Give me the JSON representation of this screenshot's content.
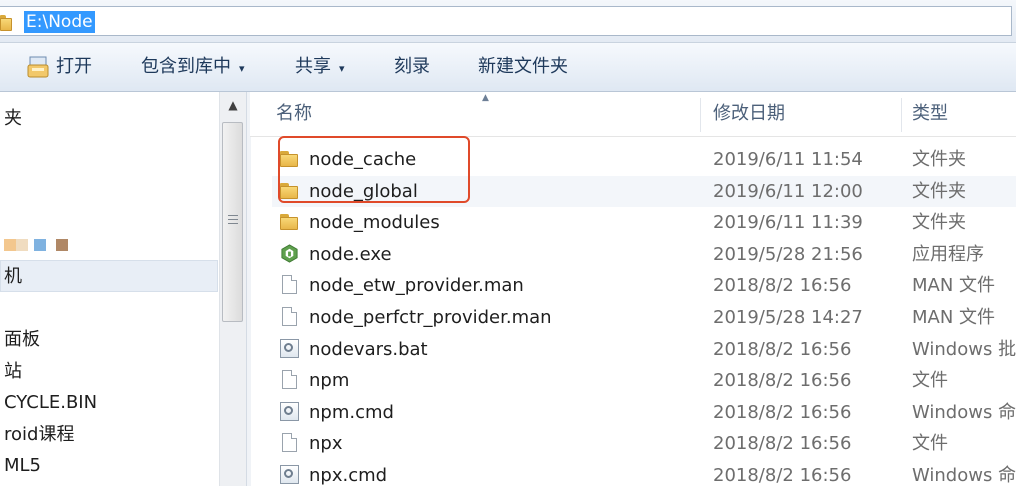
{
  "address_bar": {
    "path": "E:\\Node"
  },
  "toolbar": {
    "open_label": "打开",
    "include_label": "包含到库中",
    "share_label": "共享",
    "burn_label": "刻录",
    "new_folder_label": "新建文件夹",
    "dropdown_glyph": "▾"
  },
  "nav": {
    "items": [
      "夹",
      "机",
      "面板",
      "站",
      "CYCLE.BIN",
      "roid课程",
      "ML5"
    ],
    "swatch_colors": [
      "#f3c78e",
      "#f0dcc0",
      "#7fb2e0",
      "#b08866"
    ]
  },
  "columns": {
    "name": "名称",
    "date": "修改日期",
    "type": "类型"
  },
  "files": [
    {
      "name": "node_cache",
      "date": "2019/6/11 11:54",
      "type": "文件夹",
      "icon": "folder-icon"
    },
    {
      "name": "node_global",
      "date": "2019/6/11 12:00",
      "type": "文件夹",
      "icon": "folder-icon"
    },
    {
      "name": "node_modules",
      "date": "2019/6/11 11:39",
      "type": "文件夹",
      "icon": "folder-icon"
    },
    {
      "name": "node.exe",
      "date": "2019/5/28 21:56",
      "type": "应用程序",
      "icon": "node-exe-icon"
    },
    {
      "name": "node_etw_provider.man",
      "date": "2018/8/2 16:56",
      "type": "MAN 文件",
      "icon": "file-icon"
    },
    {
      "name": "node_perfctr_provider.man",
      "date": "2019/5/28 14:27",
      "type": "MAN 文件",
      "icon": "file-icon"
    },
    {
      "name": "nodevars.bat",
      "date": "2018/8/2 16:56",
      "type": "Windows 批",
      "icon": "batch-icon"
    },
    {
      "name": "npm",
      "date": "2018/8/2 16:56",
      "type": "文件",
      "icon": "file-icon"
    },
    {
      "name": "npm.cmd",
      "date": "2018/8/2 16:56",
      "type": "Windows 命",
      "icon": "batch-icon"
    },
    {
      "name": "npx",
      "date": "2018/8/2 16:56",
      "type": "文件",
      "icon": "file-icon"
    },
    {
      "name": "npx.cmd",
      "date": "2018/8/2 16:56",
      "type": "Windows 命",
      "icon": "batch-icon"
    }
  ],
  "annotation_color": "#e04a2a"
}
